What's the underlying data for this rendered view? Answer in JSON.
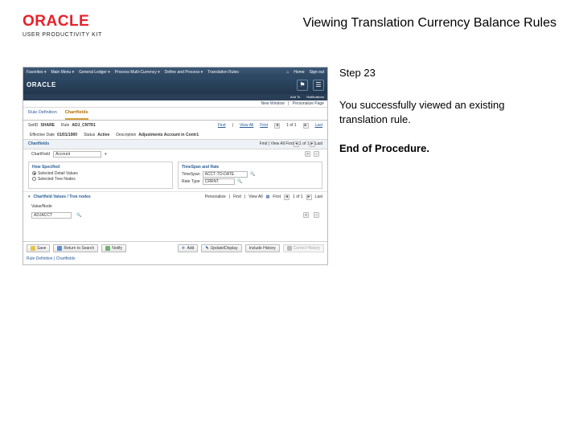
{
  "header": {
    "logo_text": "ORACLE",
    "logo_sub": "USER PRODUCTIVITY KIT",
    "title": "Viewing Translation Currency Balance Rules"
  },
  "instruction": {
    "step": "Step 23",
    "desc": "You successfully viewed an existing translation rule.",
    "end": "End of Procedure."
  },
  "app": {
    "topbar": {
      "favorites": "Favorites ▾",
      "main_menu": "Main Menu ▾",
      "gl": "General Ledger ▾",
      "multi": "Process Multi-Currency ▾",
      "rules": "Define and Process ▾",
      "rules2": "Translation Rules",
      "home": "Home",
      "signout": "Sign out"
    },
    "brand": {
      "name": "ORACLE",
      "icon1": "flag-icon",
      "icon1_label": "Add To",
      "icon2": "bell-icon",
      "icon2_label": "Notifications"
    },
    "subheader": {
      "new_window": "New Window",
      "personalize": "Personalize Page"
    },
    "tabs": {
      "tab1": "Rule Definition",
      "tab2": "Chartfields"
    },
    "row1": {
      "setid_lbl": "SetID",
      "setid_val": "SHARE",
      "rule_lbl": "Rule",
      "rule_val": "ADJ_CNTR1",
      "find": "Find",
      "viewall": "View All",
      "first": "First",
      "nav": "1 of 1",
      "last": "Last"
    },
    "row2": {
      "effdate_lbl": "Effective Date",
      "effdate_val": "01/01/1900",
      "status_lbl": "Status",
      "status_val": "Active",
      "desc_lbl": "Description",
      "desc_val": "Adjustments Account in Contr1"
    },
    "section": {
      "title": "Chartfields",
      "find": "Find",
      "viewall": "View All",
      "first": "First",
      "nav": "1 of 1",
      "last": "Last"
    },
    "cf_row": {
      "lbl": "ChartField",
      "val": "Account"
    },
    "panel_left": {
      "title": "How Specified",
      "r1": "Selected Detail Values",
      "r2": "Selected Tree Nodes"
    },
    "panel_right": {
      "title": "TimeSpan and Rate",
      "timespan_lbl": "TimeSpan",
      "timespan_val": "ACCT-TO-DATE",
      "rate_lbl": "Rate Type",
      "rate_val": "CRRNT"
    },
    "collapse": {
      "tri": "▾",
      "label_a": "Chartfield Values / Tree nodes",
      "personalize": "Personalize",
      "find": "Find",
      "viewall": "View All",
      "first": "First",
      "nav": "1 of 1",
      "last": "Last"
    },
    "sub_tb": {
      "lbl": "Value/Node",
      "val": "ADJACCT"
    },
    "footer_btns": {
      "save": "Save",
      "return": "Return to Search",
      "notify": "Notify",
      "add": "Add",
      "update": "Update/Display",
      "include": "Include History",
      "correct": "Correct History"
    },
    "footer_path": "Rule Definition | Chartfields"
  }
}
